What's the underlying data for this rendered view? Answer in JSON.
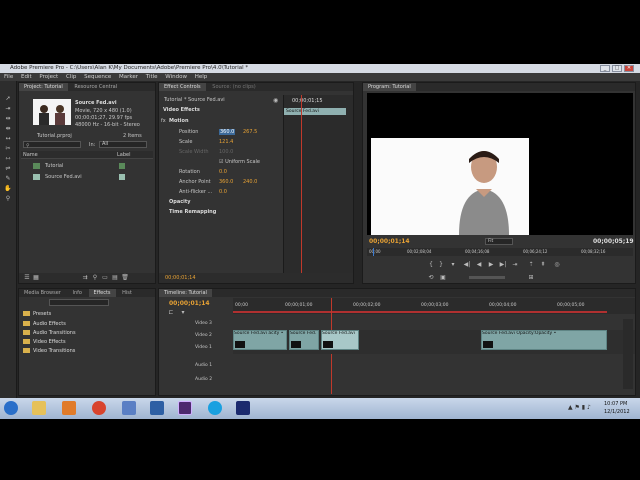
{
  "window": {
    "title": "Adobe Premiere Pro - C:\\Users\\Alan K\\My Documents\\Adobe\\Premiere Pro\\4.0\\Tutorial *",
    "minimize": "_",
    "maximize": "□",
    "close": "✕"
  },
  "menu": [
    "File",
    "Edit",
    "Project",
    "Clip",
    "Sequence",
    "Marker",
    "Title",
    "Window",
    "Help"
  ],
  "project": {
    "tabs": [
      "Project: Tutorial",
      "Resource Central"
    ],
    "clip_name": "Source Fed.avi",
    "clip_info": [
      "Movie, 720 x 480 (1.0)",
      "00;00;01;27, 29.97 fps",
      "48000 Hz - 16-bit - Stereo"
    ],
    "project_file": "Tutorial.prproj",
    "item_count": "2 Items",
    "in_label": "In:",
    "in_value": "All",
    "col_name": "Name",
    "col_label": "Label",
    "items": [
      {
        "name": "Tutorial",
        "color": "#5a8a5a"
      },
      {
        "name": "Source Fed.avi",
        "color": "#9ac0b0"
      }
    ]
  },
  "effects_panel": {
    "tabs": [
      "Media Browser",
      "Info",
      "Effects",
      "Hist"
    ],
    "folders": [
      "Presets",
      "Audio Effects",
      "Audio Transitions",
      "Video Effects",
      "Video Transitions"
    ]
  },
  "effect_controls": {
    "tabs": [
      "Effect Controls",
      "Source: (no clips)"
    ],
    "breadcrumb": "Tutorial * Source Fed.avi",
    "timecode_head": "00;00;01;15",
    "clip_label": "Source Fed.avi",
    "section": "Video Effects",
    "motion": "Motion",
    "position_label": "Position",
    "position_x": "360.0",
    "position_y": "267.5",
    "scale_label": "Scale",
    "scale_value": "121.4",
    "scale_width_label": "Scale Width",
    "scale_width_value": "100.0",
    "uniform_scale": "Uniform Scale",
    "rotation_label": "Rotation",
    "rotation_value": "0.0",
    "anchor_label": "Anchor Point",
    "anchor_x": "360.0",
    "anchor_y": "240.0",
    "antiflicker_label": "Anti-flicker ...",
    "antiflicker_value": "0.0",
    "opacity": "Opacity",
    "time_remapping": "Time Remapping",
    "timecode_bottom": "00;00;01;14"
  },
  "program_monitor": {
    "tab": "Program: Tutorial",
    "timecode_current": "00;00;01;14",
    "fit": "Fit",
    "timecode_total": "00;00;05;19",
    "ruler": [
      "00;00",
      "00;02;08;04",
      "00;04;16;08",
      "00;06;24;12",
      "00;08;32;16"
    ]
  },
  "timeline": {
    "tab": "Timeline: Tutorial",
    "timecode": "00;00;01;14",
    "ruler": [
      "00;00",
      "00;00;01;00",
      "00;00;02;00",
      "00;00;03;00",
      "00;00;04;00",
      "00;00;05;00"
    ],
    "tracks": [
      "Video 3",
      "Video 2",
      "Video 1",
      "Audio 1",
      "Audio 2"
    ],
    "clips": [
      {
        "label": "Source Fed.avi",
        "extra": "acity •"
      },
      {
        "label": "Source Fed."
      },
      {
        "label": "Source Fed.avi"
      },
      {
        "label": "Source Fed.avi",
        "extra": "Opacity:Opacity •"
      }
    ]
  },
  "taskbar": {
    "time": "10:07 PM",
    "date": "12/1/2012"
  }
}
